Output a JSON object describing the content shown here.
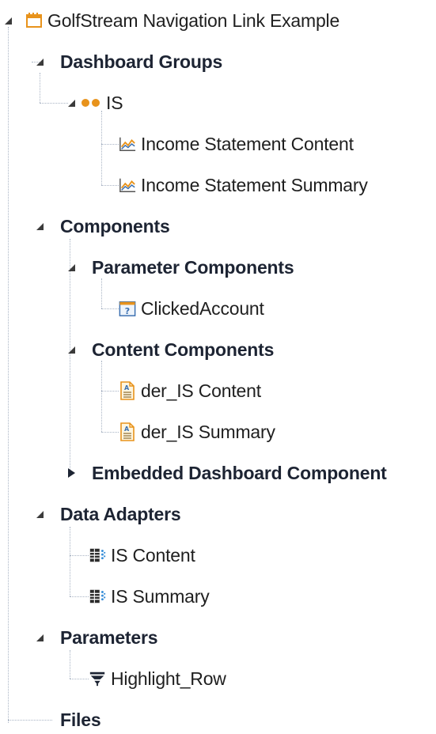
{
  "tree": {
    "root": {
      "label": "GolfStream Navigation Link Example",
      "icon": "dashboard-window-icon",
      "expanded": true
    },
    "dashboard_groups": {
      "label": "Dashboard Groups",
      "expanded": true,
      "is_group": {
        "label": "IS",
        "icon": "group-dots-icon",
        "expanded": true,
        "items": [
          {
            "label": "Income Statement Content",
            "icon": "chart-icon"
          },
          {
            "label": "Income Statement Summary",
            "icon": "chart-icon"
          }
        ]
      }
    },
    "components": {
      "label": "Components",
      "expanded": true,
      "parameter_components": {
        "label": "Parameter Components",
        "expanded": true,
        "items": [
          {
            "label": "ClickedAccount",
            "icon": "parameter-question-icon"
          }
        ]
      },
      "content_components": {
        "label": "Content Components",
        "expanded": true,
        "items": [
          {
            "label": "der_IS Content",
            "icon": "report-doc-icon"
          },
          {
            "label": "der_IS Summary",
            "icon": "report-doc-icon"
          }
        ]
      },
      "embedded_dashboard_component": {
        "label": "Embedded Dashboard Component",
        "expanded": false
      }
    },
    "data_adapters": {
      "label": "Data Adapters",
      "expanded": true,
      "items": [
        {
          "label": "IS Content",
          "icon": "data-adapter-icon"
        },
        {
          "label": "IS Summary",
          "icon": "data-adapter-icon"
        }
      ]
    },
    "parameters": {
      "label": "Parameters",
      "expanded": true,
      "items": [
        {
          "label": "Highlight_Row",
          "icon": "filter-funnel-icon"
        }
      ]
    },
    "files": {
      "label": "Files"
    }
  },
  "colors": {
    "tree_lines": "#a9b4c4",
    "group_dots": "#e8931c",
    "folder_orange": "#e8931c",
    "param_blue": "#3a6fb0",
    "text": "#1f1f1f"
  }
}
